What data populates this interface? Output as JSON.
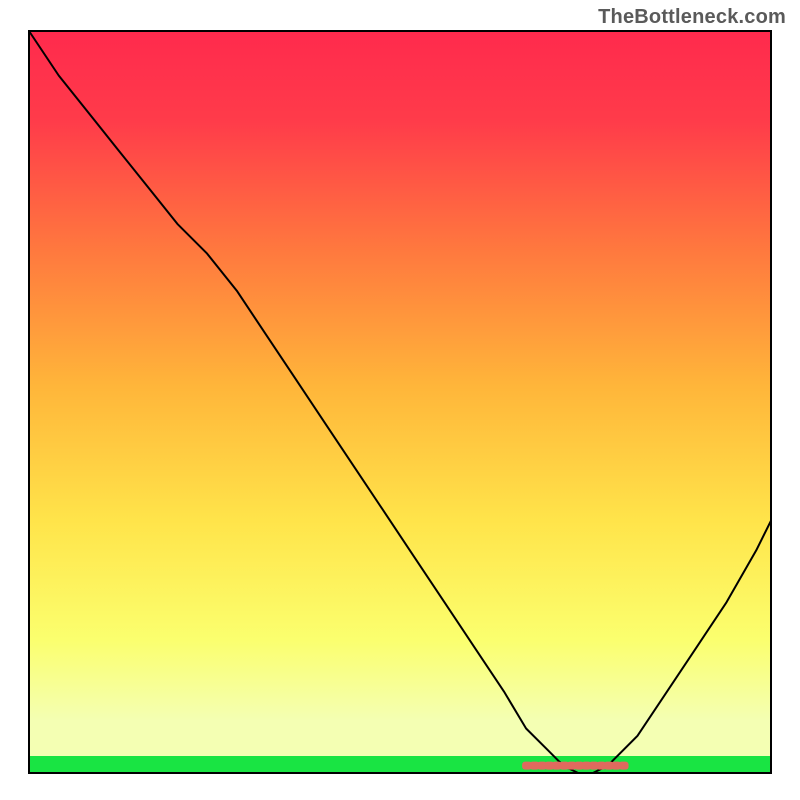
{
  "attribution": "TheBottleneck.com",
  "chart_data": {
    "type": "line",
    "title": "",
    "xlabel": "",
    "ylabel": "",
    "xlim": [
      0,
      100
    ],
    "ylim": [
      0,
      100
    ],
    "grid": false,
    "legend": false,
    "background_gradient": {
      "top": "#ff2a4d",
      "mid": "#ffd23f",
      "bottom_yellow": "#f8ff9a",
      "bottom_green": "#19e443"
    },
    "series": [
      {
        "name": "bottleneck_curve",
        "x": [
          0,
          4,
          8,
          12,
          16,
          20,
          24,
          28,
          32,
          36,
          40,
          44,
          48,
          52,
          56,
          60,
          64,
          67,
          70,
          72,
          74,
          76,
          78,
          82,
          86,
          90,
          94,
          98,
          100
        ],
        "y": [
          100,
          94,
          89,
          84,
          79,
          74,
          70,
          65,
          59,
          53,
          47,
          41,
          35,
          29,
          23,
          17,
          11,
          6,
          3,
          1,
          0,
          0,
          1,
          5,
          11,
          17,
          23,
          30,
          34
        ]
      }
    ],
    "markers": {
      "name": "highlight_segment",
      "x": [
        67,
        68,
        69,
        70,
        71,
        72,
        73,
        74,
        75,
        76,
        77,
        78,
        79,
        80
      ],
      "y": [
        1,
        1,
        1,
        1,
        1,
        1,
        1,
        1,
        1,
        1,
        1,
        1,
        1,
        1
      ],
      "color": "#e06a5e"
    }
  }
}
